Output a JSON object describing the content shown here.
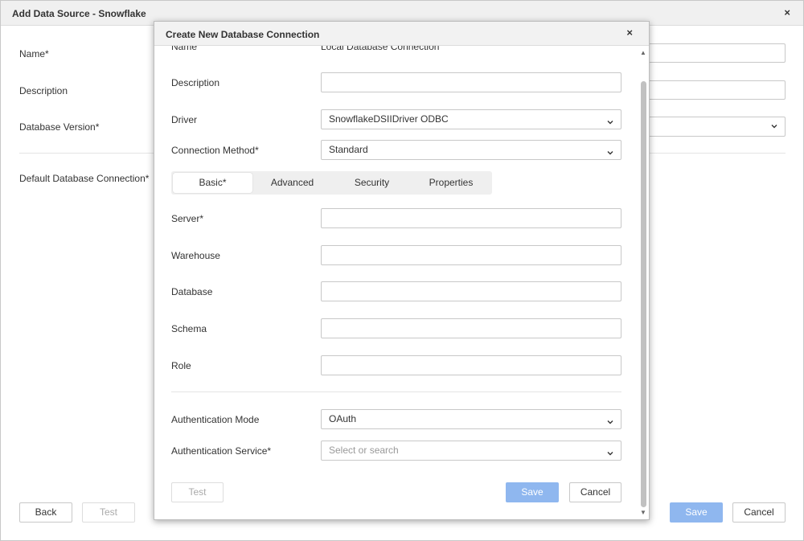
{
  "outer": {
    "title": "Add Data Source - Snowflake",
    "close": "×",
    "labels": {
      "name": "Name*",
      "description": "Description",
      "database_version": "Database Version*",
      "default_connection": "Default Database Connection*"
    },
    "buttons": {
      "back": "Back",
      "test": "Test",
      "save": "Save",
      "cancel": "Cancel"
    }
  },
  "modal": {
    "title": "Create New Database Connection",
    "close": "×",
    "name_label": "Name",
    "name_value": "Local Database Connection",
    "description_label": "Description",
    "driver_label": "Driver",
    "driver_value": "SnowflakeDSIIDriver ODBC",
    "connection_method_label": "Connection Method*",
    "connection_method_value": "Standard",
    "tabs": [
      {
        "label": "Basic*",
        "active": true
      },
      {
        "label": "Advanced",
        "active": false
      },
      {
        "label": "Security",
        "active": false
      },
      {
        "label": "Properties",
        "active": false
      }
    ],
    "fields": {
      "server": "Server*",
      "warehouse": "Warehouse",
      "database": "Database",
      "schema": "Schema",
      "role": "Role"
    },
    "auth_mode_label": "Authentication Mode",
    "auth_mode_value": "OAuth",
    "auth_service_label": "Authentication Service*",
    "auth_service_placeholder": "Select or search",
    "buttons": {
      "test": "Test",
      "save": "Save",
      "cancel": "Cancel"
    }
  },
  "icons": {
    "chevron": "chevron-down-icon",
    "close": "close-icon"
  },
  "colors": {
    "primary_button": "#8fb7ef",
    "header_bg": "#f0f0f0"
  }
}
